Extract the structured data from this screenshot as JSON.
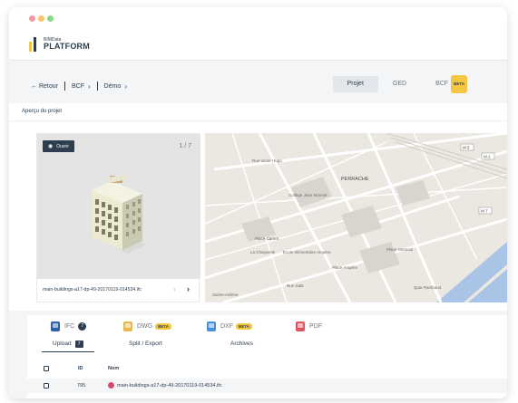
{
  "app": {
    "logo_sub": "BIMData",
    "logo_main": "PLATFORM"
  },
  "breadcrumb": {
    "back": "← Retour",
    "bcf": "BCF",
    "demo": "Démo"
  },
  "top_tabs": {
    "projet": "Projet",
    "ged": "GED",
    "bcf": "BCF",
    "beta": "BETA"
  },
  "preview": {
    "title": "Aperçu du projet",
    "open_label": "Ouvrir",
    "counter": "1 / 7",
    "filename": "main-buildings-a17-dp-49-20170119-014534.ifc"
  },
  "map": {
    "labels": [
      "Rue Victor Hugo",
      "PERRACHE",
      "Collège Jean Monnet",
      "Place Carnot",
      "École élémentaire Ampère",
      "La Charpente",
      "Place Ampère",
      "Rue Sala",
      "Quai Rambaud",
      "Place Gensoul",
      "Sainte-Hélène",
      "M 7",
      "M 5",
      "M 2"
    ]
  },
  "file_tabs": {
    "ifc": "IFC",
    "ifc_count": "7",
    "dwg": "DWG",
    "dxf": "DXF",
    "pdf": "PDF",
    "beta": "BETA"
  },
  "sub_tabs": {
    "upload": "Upload",
    "upload_count": "7",
    "split": "Split / Export",
    "archives": "Archives"
  },
  "table": {
    "headers": {
      "id": "ID",
      "name": "Nom"
    },
    "rows": [
      {
        "id": "795",
        "name": "main-buildings-a17-dp-49-20170119-014534.ifc"
      }
    ]
  },
  "colors": {
    "accent_yellow": "#f3c742",
    "dark": "#2c3e50",
    "ifc_icon": "#2f5fa8",
    "dwg_icon": "#e8b84a",
    "dxf_icon": "#4a90d9",
    "pdf_icon": "#e05561"
  }
}
